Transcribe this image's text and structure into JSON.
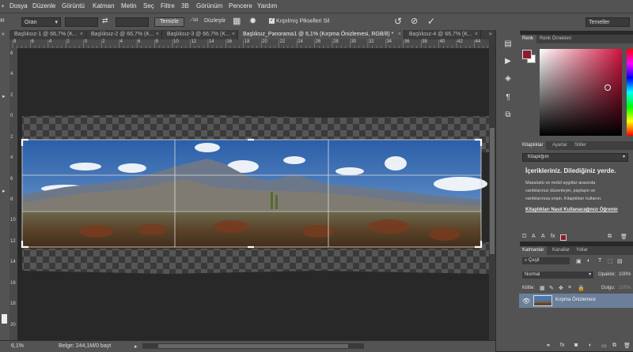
{
  "menu": [
    "Dosya",
    "Düzenle",
    "Görüntü",
    "Katman",
    "Metin",
    "Seç",
    "Filtre",
    "3B",
    "Görünüm",
    "Pencere",
    "Yardım"
  ],
  "options_bar": {
    "ratio_select": "Oran",
    "swap_icon": "swap-arrows-icon",
    "clear_button": "Temizle",
    "straighten_label": "Düzleştir",
    "overlay_icon": "grid-overlay-icon",
    "settings_icon": "gear-icon",
    "delete_cropped_label": "Kırpılmış Pikselleri Sil",
    "delete_cropped_checked": true,
    "reset_icon": "rotate-ccw-icon",
    "cancel_icon": "cancel-icon",
    "commit_icon": "checkmark-icon",
    "workspace_select": "Temeller"
  },
  "tabs": [
    {
      "label": "Başlıksız-1 @ 66,7% (K...",
      "active": false
    },
    {
      "label": "Başlıksız-2 @ 66,7% (K...",
      "active": false
    },
    {
      "label": "Başlıksız-3 @ 66,7% (K...",
      "active": false
    },
    {
      "label": "Başlıksız_Panorama1 @ 6,1% (Kırpma Önizlemesi, RGB/8) *",
      "active": true
    },
    {
      "label": "Başlıksız-4 @ 66,7% (K...",
      "active": false
    }
  ],
  "ruler_h_ticks": [
    "8",
    "6",
    "4",
    "2",
    "0",
    "2",
    "4",
    "6",
    "8",
    "10",
    "12",
    "14",
    "16",
    "18",
    "20",
    "22",
    "24",
    "26",
    "28",
    "30",
    "32",
    "34",
    "36",
    "38",
    "40",
    "42",
    "44"
  ],
  "ruler_v_ticks": [
    "6",
    "4",
    "2",
    "0",
    "2",
    "4",
    "6",
    "8",
    "10",
    "12",
    "14",
    "16",
    "18",
    "20"
  ],
  "status": {
    "zoom": "6,1%",
    "doc_info": "Belge: 244,1M/0 bayt",
    "arrow_icon": "chevron-right-icon"
  },
  "color_panel": {
    "tabs": [
      "Renk",
      "Renk Örnekleri"
    ],
    "foreground_color": "#8c1c2c",
    "background_color": "#ffffff",
    "picker_hue": "#d3133d"
  },
  "library_panel": {
    "tabs": [
      "Kitaplıklar",
      "Ayarlar",
      "Stiller"
    ],
    "dropdown": "Kitaplığım",
    "heading": "İçerikleriniz. Dilediğiniz yerde.",
    "body_lines": [
      "Masaüstü ve mobil aygıtlar arasında",
      "varlıklarınızı düzenleyin, paylaşın ve",
      "varlıklarınıza erişin. Kitaplıkları kullanın."
    ],
    "link": "Kitaplıkları Nasıl Kullanacağınızı Öğrenin",
    "swatch_color": "#8c1c2c"
  },
  "layers_panel": {
    "tabs": [
      "Katmanlar",
      "Kanallar",
      "Yollar"
    ],
    "filter": "Çeşit",
    "blend_mode": "Normal",
    "opacity_label": "Opaklık:",
    "opacity_value": "100%",
    "lock_label": "Kilitle:",
    "fill_label": "Dolgu:",
    "fill_value": "100%",
    "layer_name": "Kırpma Önizlemesi",
    "selected_color": "#6b7f9a"
  }
}
